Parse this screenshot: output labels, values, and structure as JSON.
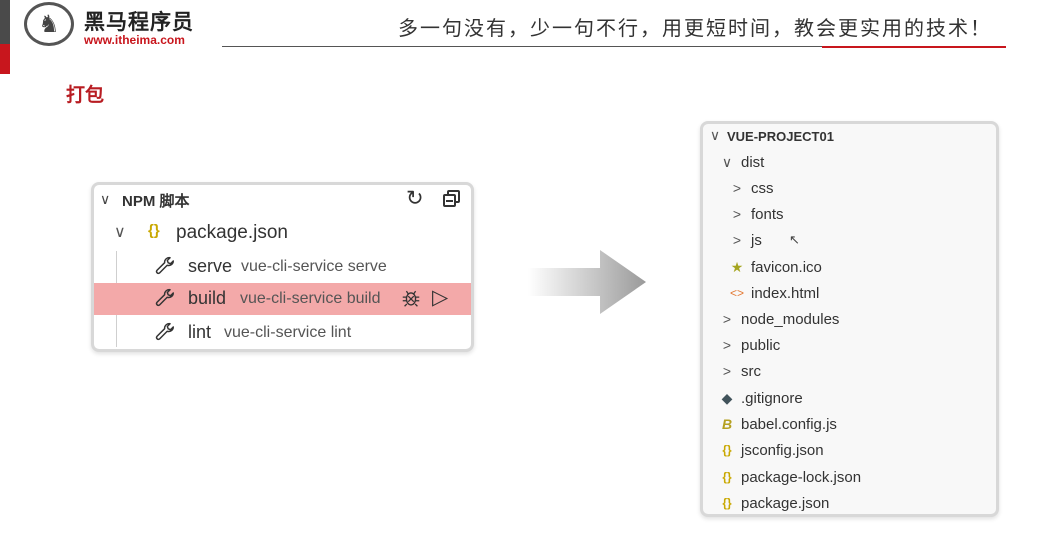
{
  "header": {
    "brand_name": "黑马程序员",
    "brand_url": "www.itheima.com",
    "slogan": "多一句没有，少一句不行，用更短时间，教会更实用的技术！",
    "logo_icon": "horse-logo-icon",
    "colors": {
      "accent": "#c8161d",
      "dark": "#4a4a4a"
    }
  },
  "section_title": "打包",
  "npm_panel": {
    "title": "NPM 脚本",
    "package_label": "package.json",
    "package_icon": "{}",
    "scripts": [
      {
        "name": "serve",
        "command": "vue-cli-service serve",
        "highlighted": false
      },
      {
        "name": "build",
        "command": "vue-cli-service build",
        "highlighted": true
      },
      {
        "name": "lint",
        "command": "vue-cli-service lint",
        "highlighted": false
      }
    ],
    "actions": {
      "refresh_icon": "refresh-icon",
      "collapse_icon": "collapse-all-icon",
      "debug_icon": "debug-icon",
      "run_icon": "run-icon"
    },
    "highlight_color": "#f3a9a9"
  },
  "explorer": {
    "root": "VUE-PROJECT01",
    "items": [
      {
        "label": "dist",
        "kind": "folder-open",
        "icon": "∨",
        "color": "#555"
      },
      {
        "label": "css",
        "kind": "folder",
        "icon": ">",
        "color": "#555"
      },
      {
        "label": "fonts",
        "kind": "folder",
        "icon": ">",
        "color": "#555"
      },
      {
        "label": "js",
        "kind": "folder",
        "icon": ">",
        "color": "#555"
      },
      {
        "label": "favicon.ico",
        "kind": "file",
        "icon": "★",
        "color": "#a5a520"
      },
      {
        "label": "index.html",
        "kind": "file",
        "icon": "<>",
        "color": "#e37933"
      },
      {
        "label": "node_modules",
        "kind": "folder",
        "icon": ">",
        "color": "#555"
      },
      {
        "label": "public",
        "kind": "folder",
        "icon": ">",
        "color": "#555"
      },
      {
        "label": "src",
        "kind": "folder",
        "icon": ">",
        "color": "#555"
      },
      {
        "label": ".gitignore",
        "kind": "file",
        "icon": "◆",
        "color": "#41535b"
      },
      {
        "label": "babel.config.js",
        "kind": "file",
        "icon": "B",
        "color": "#b5a020"
      },
      {
        "label": "jsconfig.json",
        "kind": "file",
        "icon": "{}",
        "color": "#c9a800"
      },
      {
        "label": "package-lock.json",
        "kind": "file",
        "icon": "{}",
        "color": "#c9a800"
      },
      {
        "label": "package.json",
        "kind": "file",
        "icon": "{}",
        "color": "#c9a800"
      }
    ]
  }
}
